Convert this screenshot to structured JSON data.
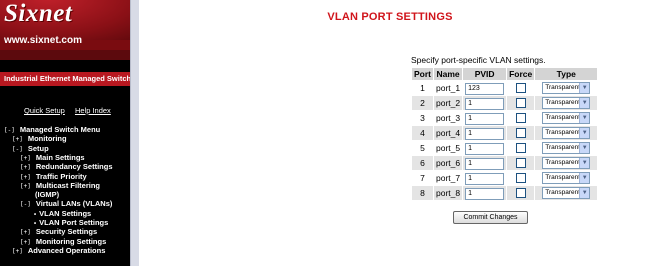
{
  "brand": {
    "logo": "Sixnet",
    "url": "www.sixnet.com",
    "product_title": "Industrial Ethernet Managed Switch"
  },
  "top_links": [
    "Quick Setup",
    "Help Index"
  ],
  "menu": [
    {
      "toggle": "[-]",
      "label": "Managed Switch Menu",
      "level": 0
    },
    {
      "toggle": "[+]",
      "label": "Monitoring",
      "level": 1
    },
    {
      "toggle": "[-]",
      "label": "Setup",
      "level": 1
    },
    {
      "toggle": "[+]",
      "label": "Main Settings",
      "level": 2
    },
    {
      "toggle": "[+]",
      "label": "Redundancy Settings",
      "level": 2
    },
    {
      "toggle": "[+]",
      "label": "Traffic Priority",
      "level": 2
    },
    {
      "toggle": "[+]",
      "label": "Multicast Filtering",
      "level": 2
    },
    {
      "toggle": "",
      "label": "(IGMP)",
      "level": 2
    },
    {
      "toggle": "[-]",
      "label": "Virtual LANs (VLANs)",
      "level": 2
    },
    {
      "toggle": "•",
      "label": "VLAN Settings",
      "level": 3
    },
    {
      "toggle": "•",
      "label": "VLAN Port Settings",
      "level": 3
    },
    {
      "toggle": "[+]",
      "label": "Security Settings",
      "level": 2
    },
    {
      "toggle": "[+]",
      "label": "Monitoring Settings",
      "level": 2
    },
    {
      "toggle": "[+]",
      "label": "Advanced Operations",
      "level": 1
    }
  ],
  "page": {
    "title": "VLAN PORT SETTINGS",
    "subtitle": "Specify port-specific VLAN settings.",
    "columns": [
      "Port",
      "Name",
      "PVID",
      "Force",
      "Type"
    ],
    "rows": [
      {
        "port": "1",
        "name": "port_1",
        "pvid": "123",
        "force": false,
        "type": "Transparent"
      },
      {
        "port": "2",
        "name": "port_2",
        "pvid": "1",
        "force": false,
        "type": "Transparent"
      },
      {
        "port": "3",
        "name": "port_3",
        "pvid": "1",
        "force": false,
        "type": "Transparent"
      },
      {
        "port": "4",
        "name": "port_4",
        "pvid": "1",
        "force": false,
        "type": "Transparent"
      },
      {
        "port": "5",
        "name": "port_5",
        "pvid": "1",
        "force": false,
        "type": "Transparent"
      },
      {
        "port": "6",
        "name": "port_6",
        "pvid": "1",
        "force": false,
        "type": "Transparent"
      },
      {
        "port": "7",
        "name": "port_7",
        "pvid": "1",
        "force": false,
        "type": "Transparent"
      },
      {
        "port": "8",
        "name": "port_8",
        "pvid": "1",
        "force": false,
        "type": "Transparent"
      }
    ],
    "commit_label": "Commit Changes"
  },
  "colors": {
    "title_red": "#d0141b",
    "sidebar_bg": "#000000",
    "brand_red": "#b81820"
  }
}
